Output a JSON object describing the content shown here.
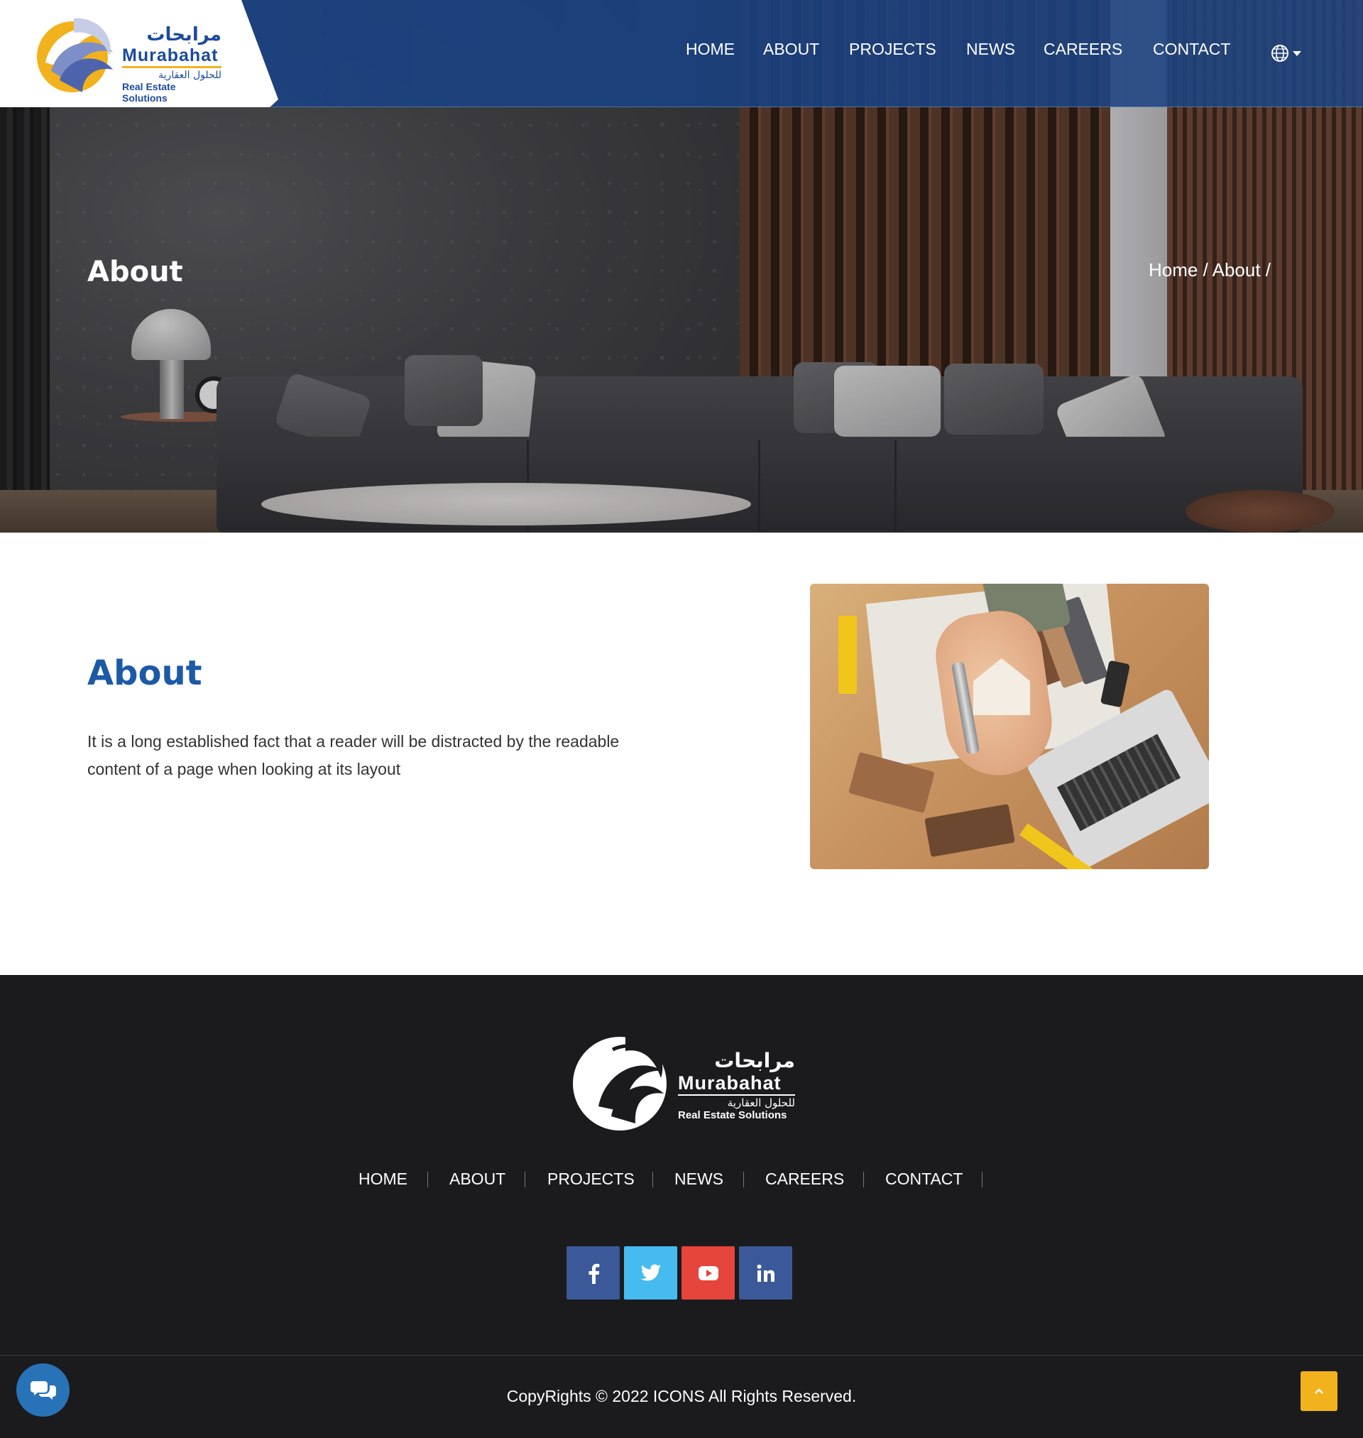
{
  "brand": {
    "name_ar": "مرابحات",
    "name_en": "Murabahat",
    "tagline_ar": "للحلول العقارية",
    "tagline_en": "Real Estate Solutions",
    "colors": {
      "primary": "#1c5aa6",
      "accent": "#f2b21d",
      "footer_bg": "#1b1b1d"
    }
  },
  "header": {
    "nav": [
      {
        "label": "HOME"
      },
      {
        "label": "ABOUT"
      },
      {
        "label": "PROJECTS"
      },
      {
        "label": "NEWS"
      },
      {
        "label": "CAREERS"
      },
      {
        "label": "CONTACT"
      }
    ],
    "language_icon": "globe-icon"
  },
  "hero": {
    "title": "About",
    "breadcrumb": {
      "home": "Home",
      "separator": " / ",
      "current": "About",
      "trailing": " /"
    }
  },
  "about": {
    "heading": "About",
    "text": "It is a long established fact that a reader will be distracted by the readable content of a page when looking at its layout"
  },
  "footer": {
    "nav": [
      {
        "label": "HOME"
      },
      {
        "label": "ABOUT"
      },
      {
        "label": "PROJECTS"
      },
      {
        "label": "NEWS"
      },
      {
        "label": "CAREERS"
      },
      {
        "label": "CONTACT"
      }
    ],
    "social": [
      {
        "name": "facebook",
        "glyph": "f",
        "color": "#3b5998"
      },
      {
        "name": "twitter",
        "glyph": "t",
        "color": "#45bbf0"
      },
      {
        "name": "youtube",
        "glyph": "▶",
        "color": "#e5453b"
      },
      {
        "name": "linkedin",
        "glyph": "in",
        "color": "#3b5998"
      }
    ],
    "copyright": "CopyRights © 2022 ICONS All Rights Reserved."
  },
  "floating": {
    "chat_icon": "chat-bubbles-icon",
    "scroll_top_icon": "chevron-up-icon"
  }
}
